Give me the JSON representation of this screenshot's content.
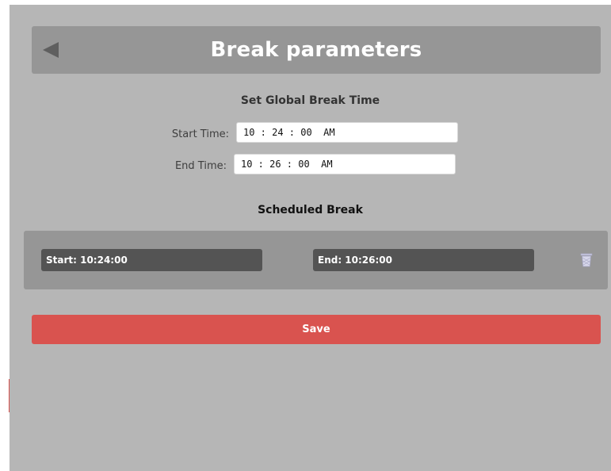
{
  "header": {
    "title": "Break parameters",
    "back_icon": "back-arrow-icon"
  },
  "global_break": {
    "heading": "Set Global Break Time",
    "start_label": "Start Time:",
    "start_value": "10 : 24 : 00  AM",
    "end_label": "End Time:",
    "end_value": "10 : 26 : 00  AM"
  },
  "scheduled_break": {
    "heading": "Scheduled Break",
    "items": [
      {
        "start": "Start: 10:24:00",
        "end": "End: 10:26:00",
        "delete_icon": "trash-bin-icon"
      }
    ]
  },
  "actions": {
    "save_label": "Save"
  },
  "colors": {
    "background": "#b6b6b6",
    "header": "#969696",
    "panel": "#969696",
    "field": "#545454",
    "save_button": "#d9534f",
    "title_text": "#ffffff"
  }
}
